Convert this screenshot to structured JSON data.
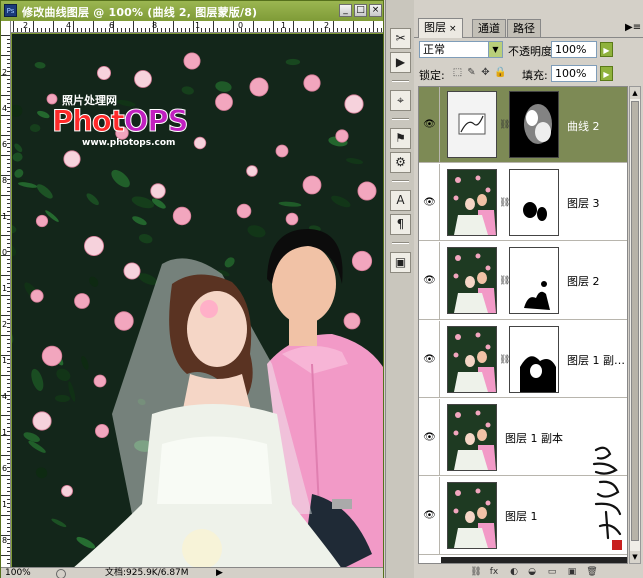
{
  "document": {
    "title": "修改曲线图层 @ 100% (曲线 2, 图层蒙版/8)",
    "app_icon_label": "Ps",
    "ruler_top_labels": [
      "2",
      "4",
      "6",
      "8",
      "1",
      "0",
      "1",
      "2"
    ],
    "ruler_left_labels": [
      "2",
      "4",
      "6",
      "8",
      "1",
      "0",
      "1",
      "2",
      "1",
      "4",
      "1",
      "6",
      "1",
      "8"
    ],
    "status_zoom": "100%",
    "status_doc": "文档:925.9K/6.87M",
    "status_arrow": "▶"
  },
  "watermark": {
    "top_text": "照片处理网",
    "logo_part1": "Phot",
    "logo_part2": "OPS",
    "url": "www.photops.com"
  },
  "tools": [
    "✂",
    "▶",
    "⌖",
    "⚑",
    "⚙",
    "A",
    "¶",
    "▣"
  ],
  "layers_panel": {
    "tabs": [
      {
        "label": "图层",
        "active": true,
        "close": "×"
      },
      {
        "label": "通道",
        "active": false
      },
      {
        "label": "路径",
        "active": false
      }
    ],
    "menu_icon": "▶≡",
    "blend_mode": "正常",
    "opacity_label": "不透明度:",
    "opacity_value": "100%",
    "lock_label": "锁定:",
    "lock_icons": [
      "⬚",
      "✎",
      "✥",
      "🔒"
    ],
    "fill_label": "填充:",
    "fill_value": "100%",
    "layers": [
      {
        "name": "曲线 2",
        "type": "adjustment",
        "active": true
      },
      {
        "name": "图层 3",
        "type": "masked",
        "active": false
      },
      {
        "name": "图层 2",
        "type": "masked",
        "active": false
      },
      {
        "name": "图层 1 副…",
        "type": "masked",
        "active": false
      },
      {
        "name": "图层 1 副本",
        "type": "plain",
        "active": false
      },
      {
        "name": "图层 1",
        "type": "plain",
        "active": false
      }
    ],
    "bottom_icons": [
      "⛓",
      "fx",
      "◐",
      "◒",
      "▭",
      "▣",
      "🗑"
    ]
  },
  "colors": {
    "title_green": "#7f9b37",
    "active_layer": "#7d8a55",
    "shirt_pink": "#f29ac7"
  }
}
